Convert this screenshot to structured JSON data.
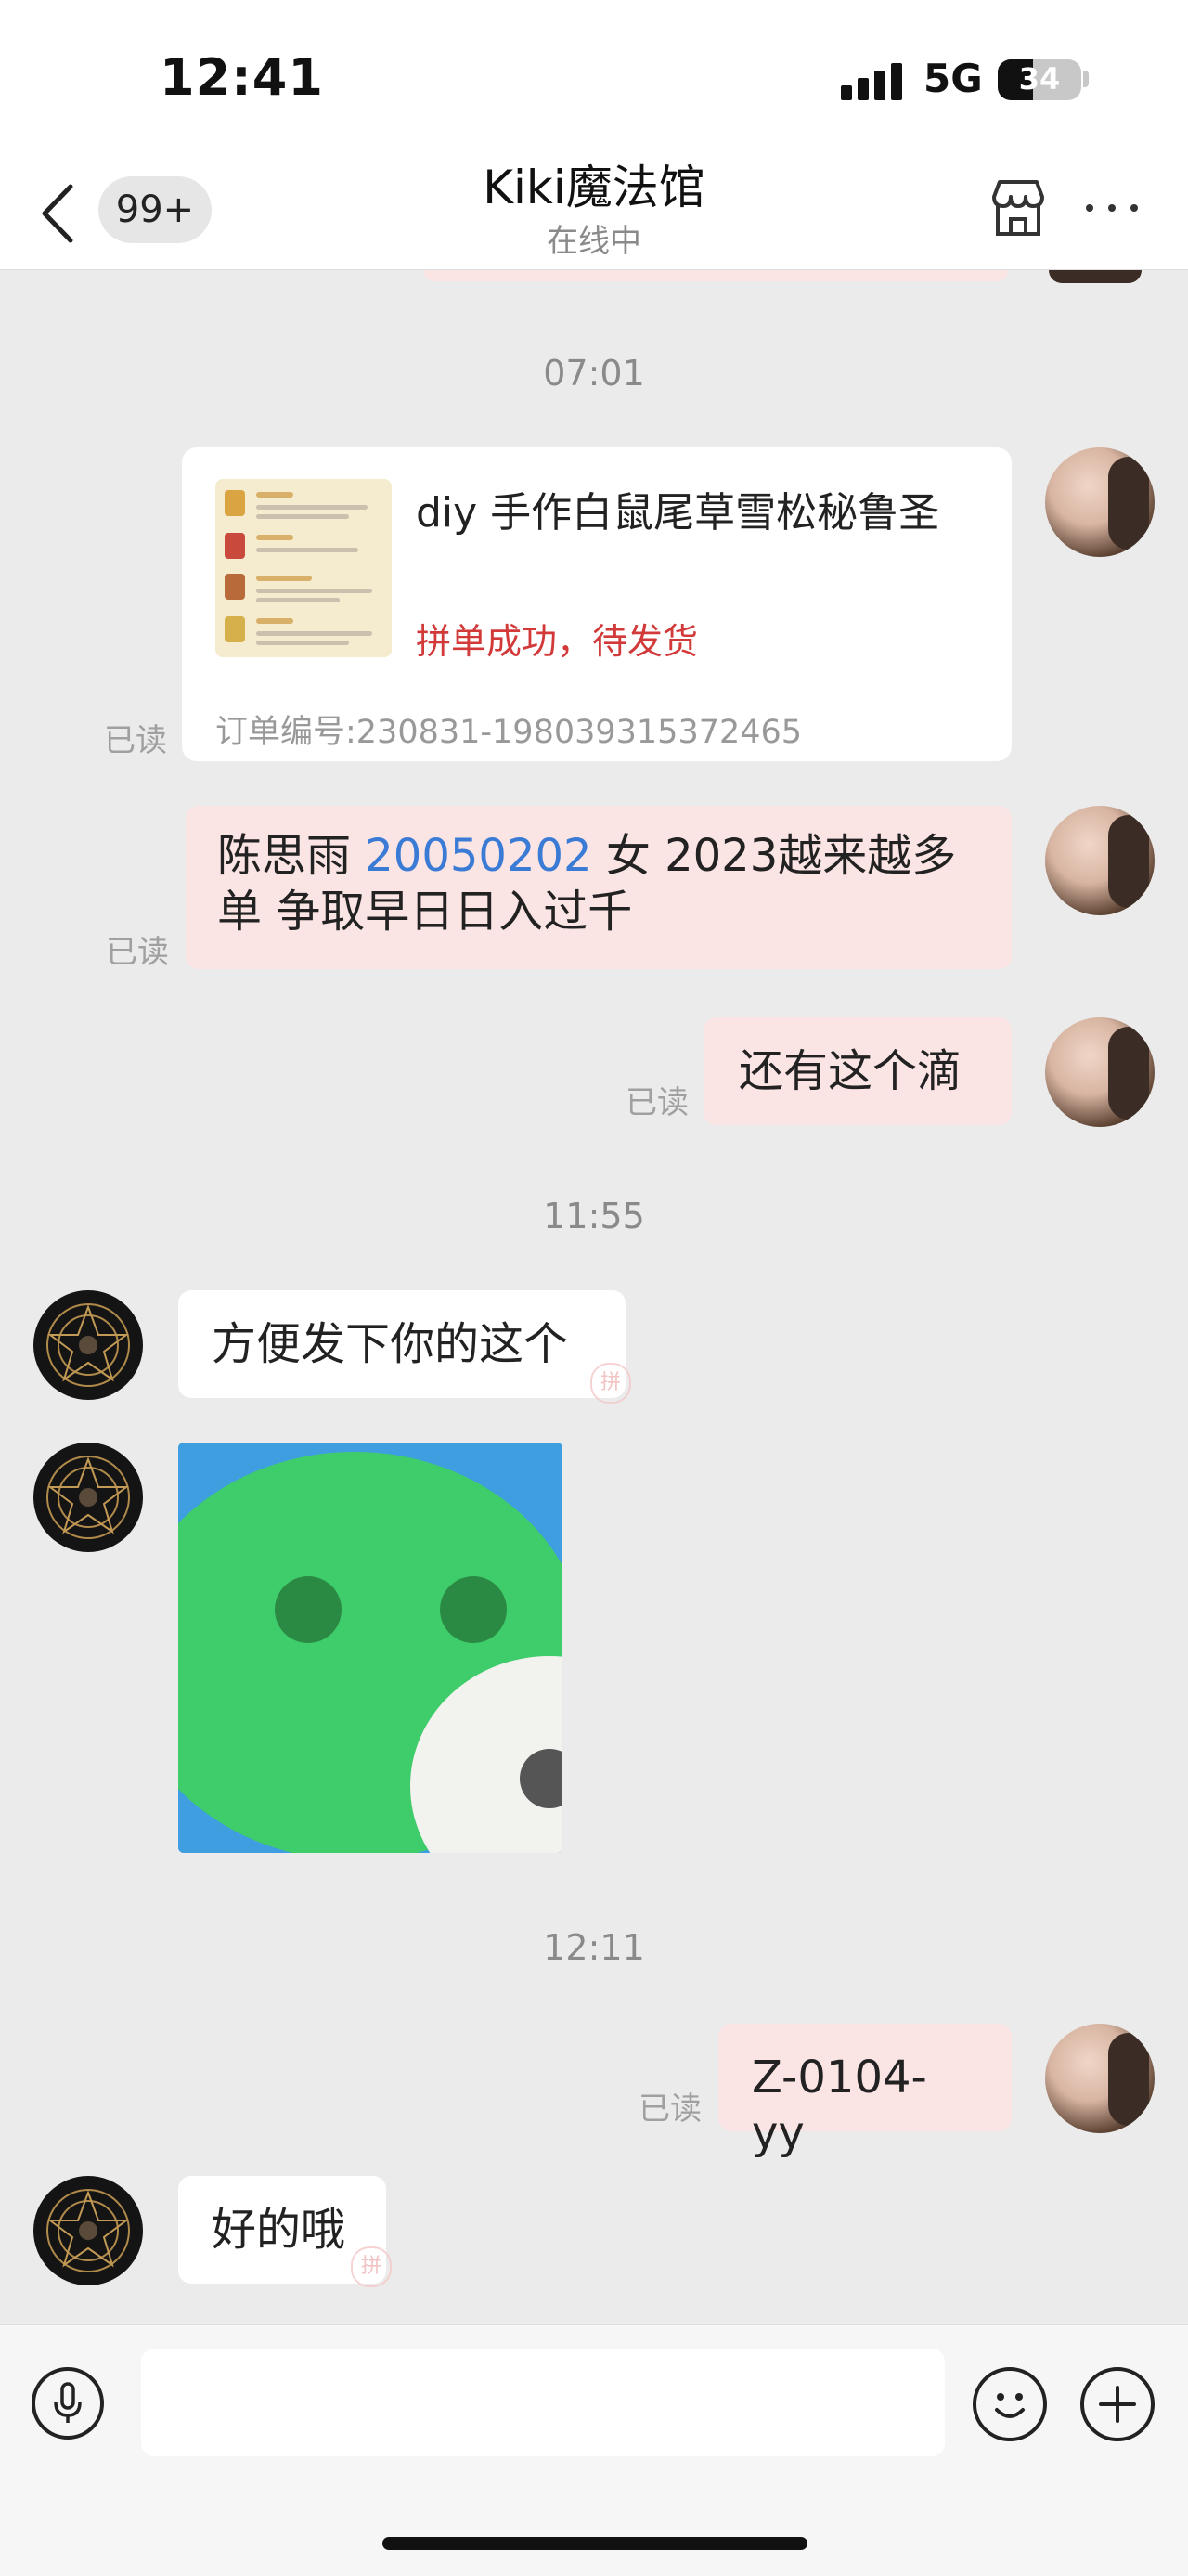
{
  "status_bar": {
    "time": "12:41",
    "network": "5G",
    "battery": "34"
  },
  "nav": {
    "back_icon": "chevron-left-icon",
    "unread_badge": "99+",
    "title": "Kiki魔法馆",
    "subtitle": "在线中",
    "store_icon": "store-icon",
    "more_icon": "more-dots-icon"
  },
  "messages": {
    "ts1": "07:01",
    "order_card": {
      "title": "diy 手作白鼠尾草雪松秘鲁圣",
      "status": "拼单成功，待发货",
      "order_no": "订单编号:230831-198039315372465",
      "read": "已读"
    },
    "msg2": {
      "pre": "陈思雨 ",
      "highlight": "20050202",
      "post": " 女 2023越来越多单 争取早日日入过千",
      "read": "已读"
    },
    "msg3": {
      "text": "还有这个滴",
      "read": "已读"
    },
    "ts2": "11:55",
    "msg4": {
      "text": "方便发下你的这个"
    },
    "ts3": "12:11",
    "msg6": {
      "text": "Z-0104-yy",
      "read": "已读"
    },
    "msg7": {
      "text": "好的哦"
    }
  },
  "stamp_char": "拼",
  "colors": {
    "my_bubble": "#fbe4e4",
    "their_bubble": "#ffffff",
    "link_blue": "#3a7bd5",
    "status_red": "#d23a3a"
  },
  "toolbar": {
    "mic_icon": "microphone-icon",
    "emoji_icon": "emoji-icon",
    "plus_icon": "plus-icon"
  }
}
